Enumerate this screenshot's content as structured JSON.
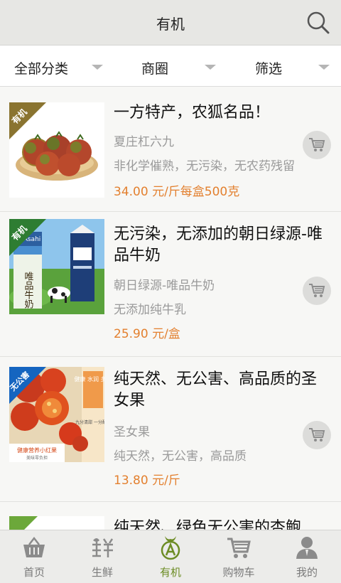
{
  "header": {
    "title": "有机",
    "search_icon": "search-icon"
  },
  "filters": [
    {
      "label": "全部分类"
    },
    {
      "label": "商圈"
    },
    {
      "label": "筛选"
    }
  ],
  "items": [
    {
      "badge": "有机",
      "title": "一方特产，农狐名品！",
      "subtitle": "夏庄杠六九",
      "desc": "非化学催熟，无污染，无农药残留",
      "price": "34.00 元/斤每盒500克"
    },
    {
      "badge": "有机",
      "title": "无污染，无添加的朝日绿源-唯品牛奶",
      "subtitle": "朝日绿源-唯品牛奶",
      "desc": "无添加纯牛乳",
      "price": "25.90 元/盒",
      "image_text": {
        "brand": "Asahi",
        "product": "唯品牛奶"
      }
    },
    {
      "badge": "无公害",
      "title": "纯天然、无公害、高品质的圣女果",
      "subtitle": "圣女果",
      "desc": "纯天然，无公害，高品质",
      "price": "13.80 元/斤",
      "image_text": {
        "side": "健康 水润 多汁",
        "note": "九分清甜 一分酸爽",
        "caption": "健康营养小红果",
        "caption_sub": "美味零负担"
      }
    },
    {
      "title": "纯天然、绿色无公害的杏鲍"
    }
  ],
  "tabs": [
    {
      "label": "首页",
      "icon": "basket-icon",
      "active": false
    },
    {
      "label": "生鲜",
      "icon": "fresh-icon",
      "active": false
    },
    {
      "label": "有机",
      "icon": "organic-icon",
      "active": true
    },
    {
      "label": "购物车",
      "icon": "cart-icon",
      "active": false
    },
    {
      "label": "我的",
      "icon": "user-icon",
      "active": false
    }
  ],
  "colors": {
    "accent": "#6c8c24",
    "price": "#e3802f",
    "badge_organic": "#8a7430",
    "badge_pollution_free": "#1565c0"
  }
}
